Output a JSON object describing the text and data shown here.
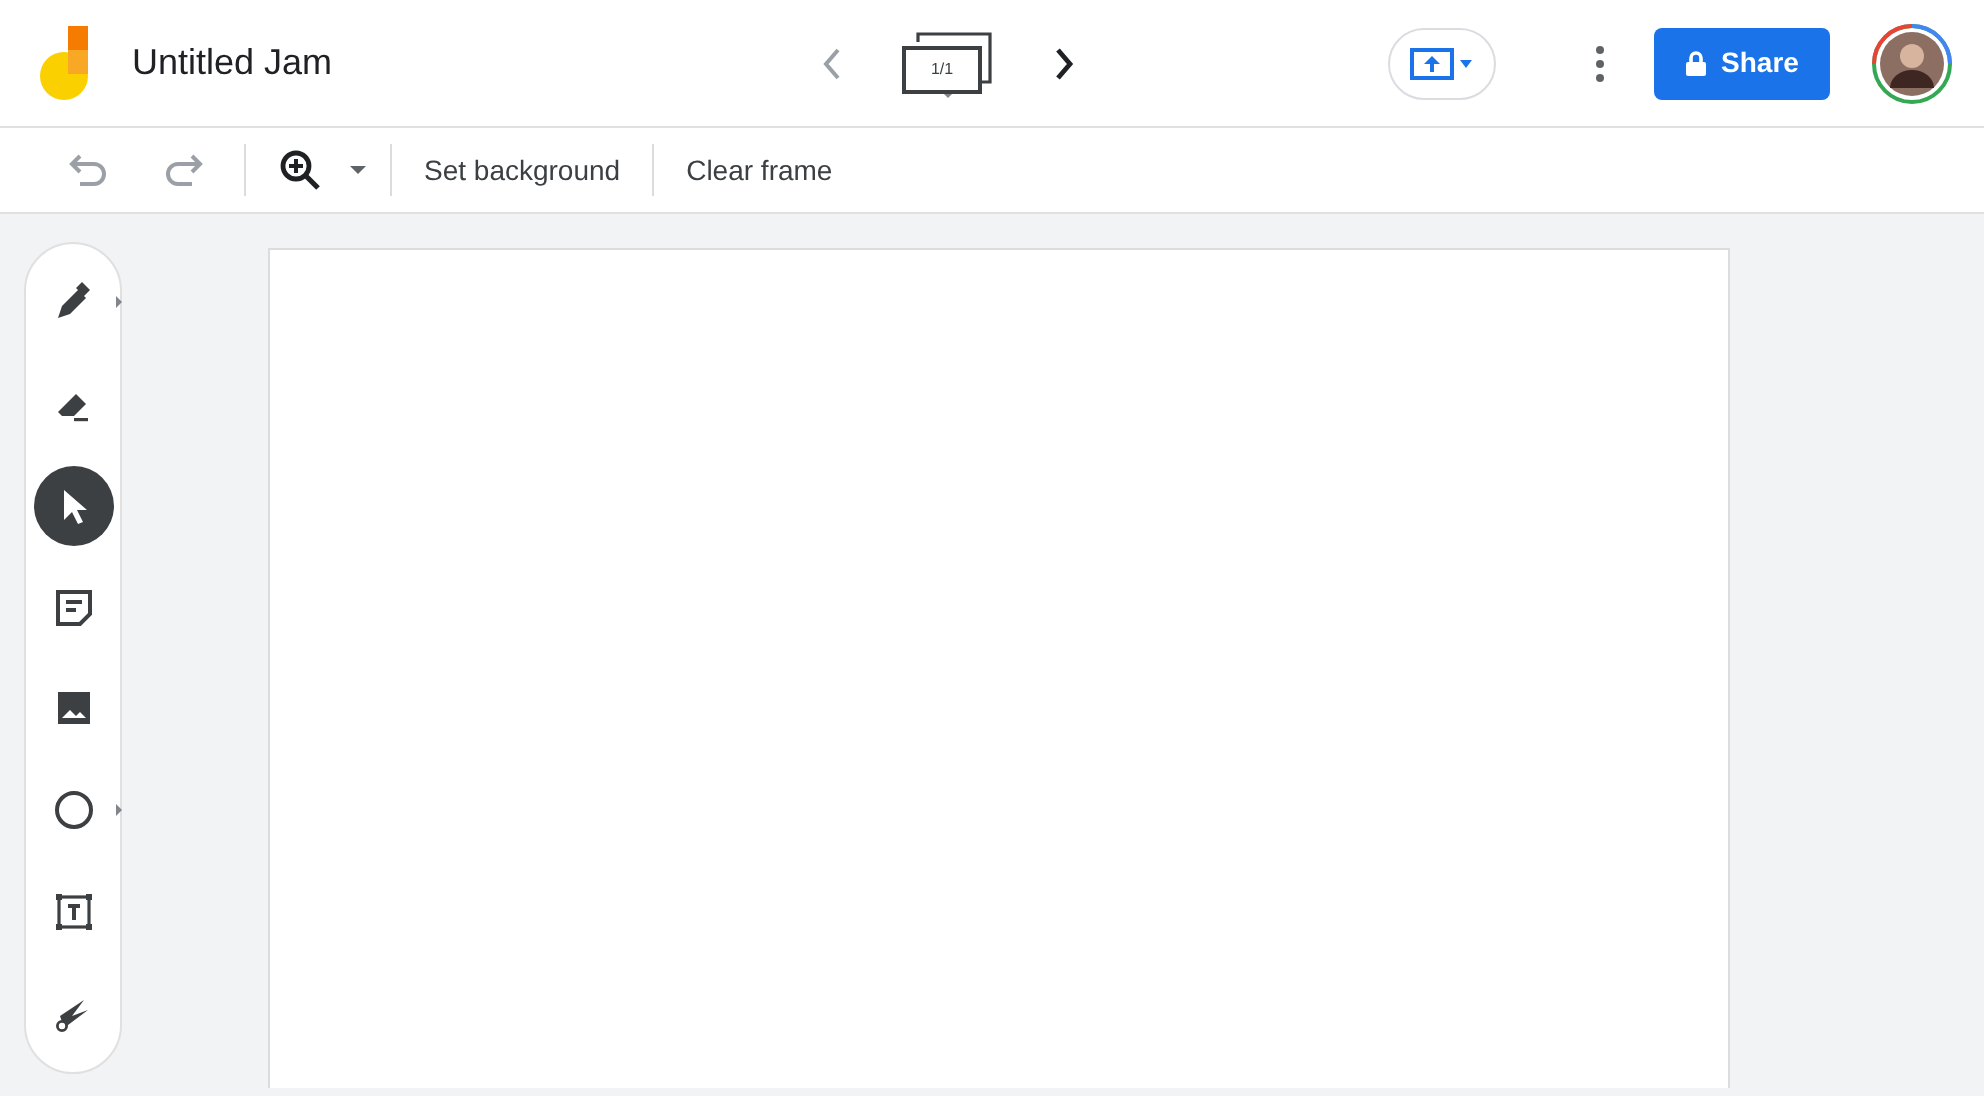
{
  "app": {
    "title": "Untitled Jam"
  },
  "frame_nav": {
    "prev": {
      "disabled": true
    },
    "counter": "1/1",
    "next": {
      "disabled": false
    }
  },
  "toolbar": {
    "undo": {
      "disabled": true
    },
    "redo": {
      "disabled": true
    },
    "actions": [
      "Set background",
      "Clear frame"
    ]
  },
  "share": {
    "label": "Share"
  },
  "tools": [
    {
      "kind": "pen",
      "selected": false,
      "has_menu": true
    },
    {
      "kind": "eraser",
      "selected": false,
      "has_menu": false
    },
    {
      "kind": "select",
      "selected": true,
      "has_menu": false
    },
    {
      "kind": "sticky-note",
      "selected": false,
      "has_menu": false
    },
    {
      "kind": "image",
      "selected": false,
      "has_menu": false
    },
    {
      "kind": "circle",
      "selected": false,
      "has_menu": true
    },
    {
      "kind": "text-box",
      "selected": false,
      "has_menu": false
    },
    {
      "kind": "laser",
      "selected": false,
      "has_menu": false
    }
  ]
}
